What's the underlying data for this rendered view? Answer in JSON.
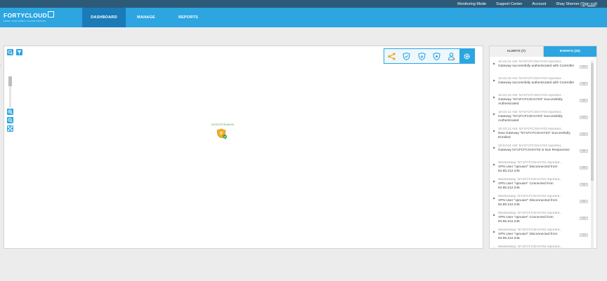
{
  "topbar": {
    "monitoring_mode": "Monitoring Mode",
    "support_center": "Support Center",
    "account": "Account",
    "user": "Shay Shemer",
    "sign_out": "(Sign out)"
  },
  "brand": {
    "name": "FORTYCLOUD",
    "tagline": "MAKE YOUR PUBLIC CLOUD PRIVATE"
  },
  "nav": {
    "tabs": [
      "DASHBOARD",
      "MANAGE",
      "REPORTS"
    ],
    "active": "DASHBOARD"
  },
  "map": {
    "node_label": "NY1FCFCSHAY03",
    "toolbar_icons": [
      "share-icon",
      "shield-icon",
      "shield-icon",
      "shield-icon",
      "user-pin-icon",
      "gear-icon"
    ],
    "left_controls": [
      "zoom-to-fit-icon",
      "filter-icon",
      "zoom-in-icon",
      "zoom-out-icon",
      "fullscreen-icon"
    ]
  },
  "side": {
    "tabs": {
      "alerts": "ALERTS (7)",
      "events": "EVENTS (20)"
    },
    "active_tab": "EVENTS (20)",
    "more_label": "•••",
    "events": [
      {
        "time": "10:42:24 AM: NY1FCFCSHAY03 reported...",
        "desc": "Gateway successfully authenticated with Controller"
      },
      {
        "time": "10:42:15 AM: NY1FCFCSHAY03 reported...",
        "desc": "Gateway successfully authenticated with Controller"
      },
      {
        "time": "10:42:15 AM: NY1FCFCSHAY03 reported...",
        "desc": "Gateway \"NY1FCFCSHAY03\" Successfully Authenticated"
      },
      {
        "time": "10:42:14 AM: NY1FCFCSHAY03 reported...",
        "desc": "Gateway \"NY1FCFCSHAY03\" Successfully Authenticated"
      },
      {
        "time": "10:42:13 AM: NY1FCFCSHAY03 reported...",
        "desc": "New Gateway \"NY1FCFCSHAY03\" Successfully Enrolled"
      },
      {
        "time": "10:04:04 AM: NY1FCFCSHAY03 reported...",
        "desc": "Gateway NY1FCFCSHAY03 is Non Responsive"
      },
      {
        "time": "Wednesday: NY1FCFCSHAY02 reported...",
        "desc": "VPN User \"vpnuser\" Disconnected from 84.95.212.245"
      },
      {
        "time": "Wednesday: NY1FCFCSHAY02 reported...",
        "desc": "VPN User \"vpnuser\" Connected from 84.95.212.245"
      },
      {
        "time": "Wednesday: NY1FCFCSHAY02 reported...",
        "desc": "VPN User \"vpnuser\" Disconnected from 84.95.212.245"
      },
      {
        "time": "Wednesday: NY1FCFCSHAY02 reported...",
        "desc": "VPN User \"vpnuser\" Connected from 84.95.212.245"
      },
      {
        "time": "Wednesday: NY1FCFCSHAY02 reported...",
        "desc": "VPN User \"vpnuser\" Disconnected from 84.95.212.245"
      },
      {
        "time": "Wednesday: NY1FCFCSHAY02 reported...",
        "desc": ""
      }
    ]
  },
  "colors": {
    "topbar": "#2d5a79",
    "navbar": "#2ca5e0",
    "nav_active": "#1b7bb8",
    "node_label": "#3aa34a",
    "node_icon": "#f0b020"
  }
}
